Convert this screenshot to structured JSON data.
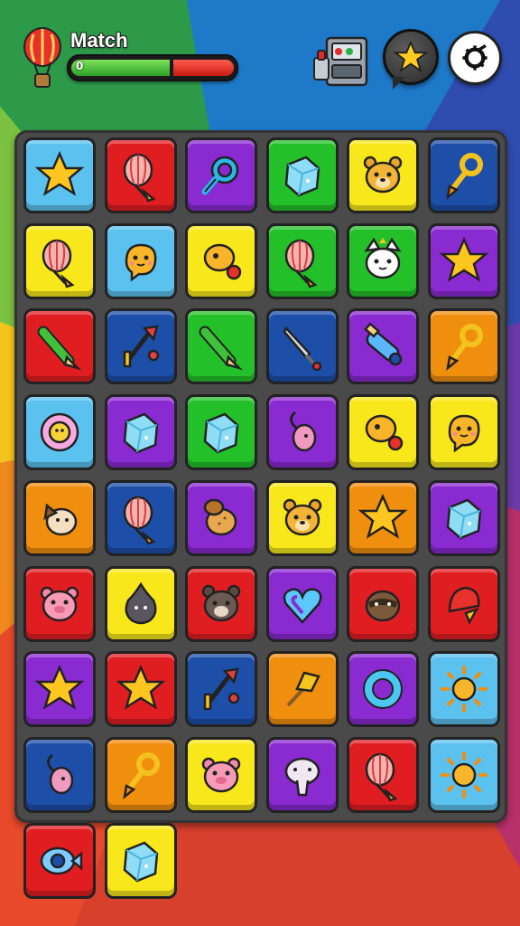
{
  "hud": {
    "title": "Match",
    "progress_label": "0",
    "progress": 0.62,
    "balloon_icon": "hot-air-balloon-icon",
    "machine_icon": "machine-icon",
    "star_icon": "star-icon",
    "settings_icon": "settings-icon"
  },
  "colors": {
    "blue": "#5bc1ef",
    "red": "#e01e22",
    "purple": "#8a2ad1",
    "green": "#24c02a",
    "yellow": "#f8e81b",
    "navy": "#1d4fa8",
    "orange": "#f08e0e"
  },
  "board": {
    "rows": [
      [
        {
          "color": "blue",
          "icon": "star"
        },
        {
          "color": "red",
          "icon": "balloon"
        },
        {
          "color": "purple",
          "icon": "magnifier"
        },
        {
          "color": "green",
          "icon": "ice-cube"
        },
        {
          "color": "yellow",
          "icon": "bear"
        },
        {
          "color": "navy",
          "icon": "hook"
        }
      ],
      [
        {
          "color": "yellow",
          "icon": "balloon"
        },
        {
          "color": "blue",
          "icon": "chick"
        },
        {
          "color": "yellow",
          "icon": "chick-ball"
        },
        {
          "color": "green",
          "icon": "balloon"
        },
        {
          "color": "green",
          "icon": "cat"
        },
        {
          "color": "purple",
          "icon": "star"
        }
      ],
      [
        {
          "color": "red",
          "icon": "pencil"
        },
        {
          "color": "navy",
          "icon": "tools"
        },
        {
          "color": "green",
          "icon": "pencil"
        },
        {
          "color": "navy",
          "icon": "dagger"
        },
        {
          "color": "purple",
          "icon": "bottle"
        },
        {
          "color": "orange",
          "icon": "hook"
        }
      ],
      [
        {
          "color": "blue",
          "icon": "sunflower"
        },
        {
          "color": "purple",
          "icon": "ice-cube"
        },
        {
          "color": "green",
          "icon": "ice-cube"
        },
        {
          "color": "purple",
          "icon": "mouse"
        },
        {
          "color": "yellow",
          "icon": "chick-ball"
        },
        {
          "color": "yellow",
          "icon": "chick"
        }
      ],
      [
        {
          "color": "orange",
          "icon": "dog"
        },
        {
          "color": "navy",
          "icon": "balloon"
        },
        {
          "color": "purple",
          "icon": "bread"
        },
        {
          "color": "yellow",
          "icon": "bear"
        },
        {
          "color": "orange",
          "icon": "star"
        },
        {
          "color": "purple",
          "icon": "ice-cube"
        }
      ],
      [
        {
          "color": "red",
          "icon": "pig"
        },
        {
          "color": "yellow",
          "icon": "blob"
        },
        {
          "color": "red",
          "icon": "bear-dark"
        },
        {
          "color": "purple",
          "icon": "heart"
        },
        {
          "color": "red",
          "icon": "raccoon"
        },
        {
          "color": "red",
          "icon": "bell"
        }
      ],
      [
        {
          "color": "purple",
          "icon": "star"
        },
        {
          "color": "red",
          "icon": "star"
        },
        {
          "color": "navy",
          "icon": "tools"
        },
        {
          "color": "orange",
          "icon": "broom"
        },
        {
          "color": "purple",
          "icon": "ring"
        },
        {
          "color": "blue",
          "icon": "sun"
        }
      ],
      [
        {
          "color": "navy",
          "icon": "mouse"
        },
        {
          "color": "orange",
          "icon": "hook"
        },
        {
          "color": "yellow",
          "icon": "pig"
        },
        {
          "color": "purple",
          "icon": "alien"
        },
        {
          "color": "red",
          "icon": "balloon"
        },
        {
          "color": "blue",
          "icon": "sun"
        }
      ],
      [
        {
          "color": "red",
          "icon": "fish"
        },
        {
          "color": "yellow",
          "icon": "ice-cube"
        }
      ]
    ]
  }
}
